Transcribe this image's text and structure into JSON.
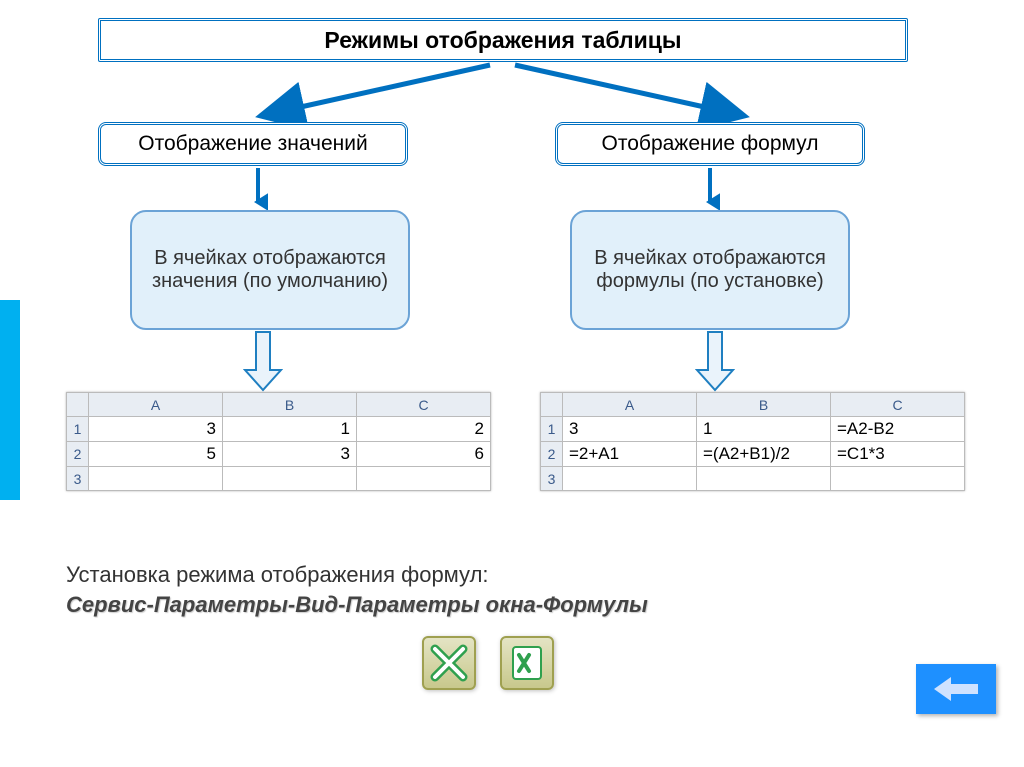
{
  "title": "Режимы отображения таблицы",
  "modes": {
    "left": "Отображение значений",
    "right": "Отображение формул"
  },
  "descriptions": {
    "left": "В ячейках отображаются значения (по умолчанию)",
    "right": "В ячейках отображаются формулы (по установке)"
  },
  "sheets": {
    "left": {
      "columns": [
        "A",
        "B",
        "C"
      ],
      "rows": [
        [
          "3",
          "1",
          "2"
        ],
        [
          "5",
          "3",
          "6"
        ],
        [
          "",
          "",
          ""
        ]
      ]
    },
    "right": {
      "columns": [
        "A",
        "B",
        "C"
      ],
      "rows": [
        [
          "3",
          "1",
          "=A2-B2"
        ],
        [
          "=2+A1",
          "=(A2+B1)/2",
          "=C1*3"
        ],
        [
          "",
          "",
          ""
        ]
      ]
    }
  },
  "caption": "Установка режима отображения формул:",
  "caption_path": "Сервис-Параметры-Вид-Параметры окна-Формулы",
  "icons": {
    "excel_old": "excel-old-icon",
    "excel_new": "excel-new-icon"
  },
  "nav": {
    "back": "back"
  }
}
